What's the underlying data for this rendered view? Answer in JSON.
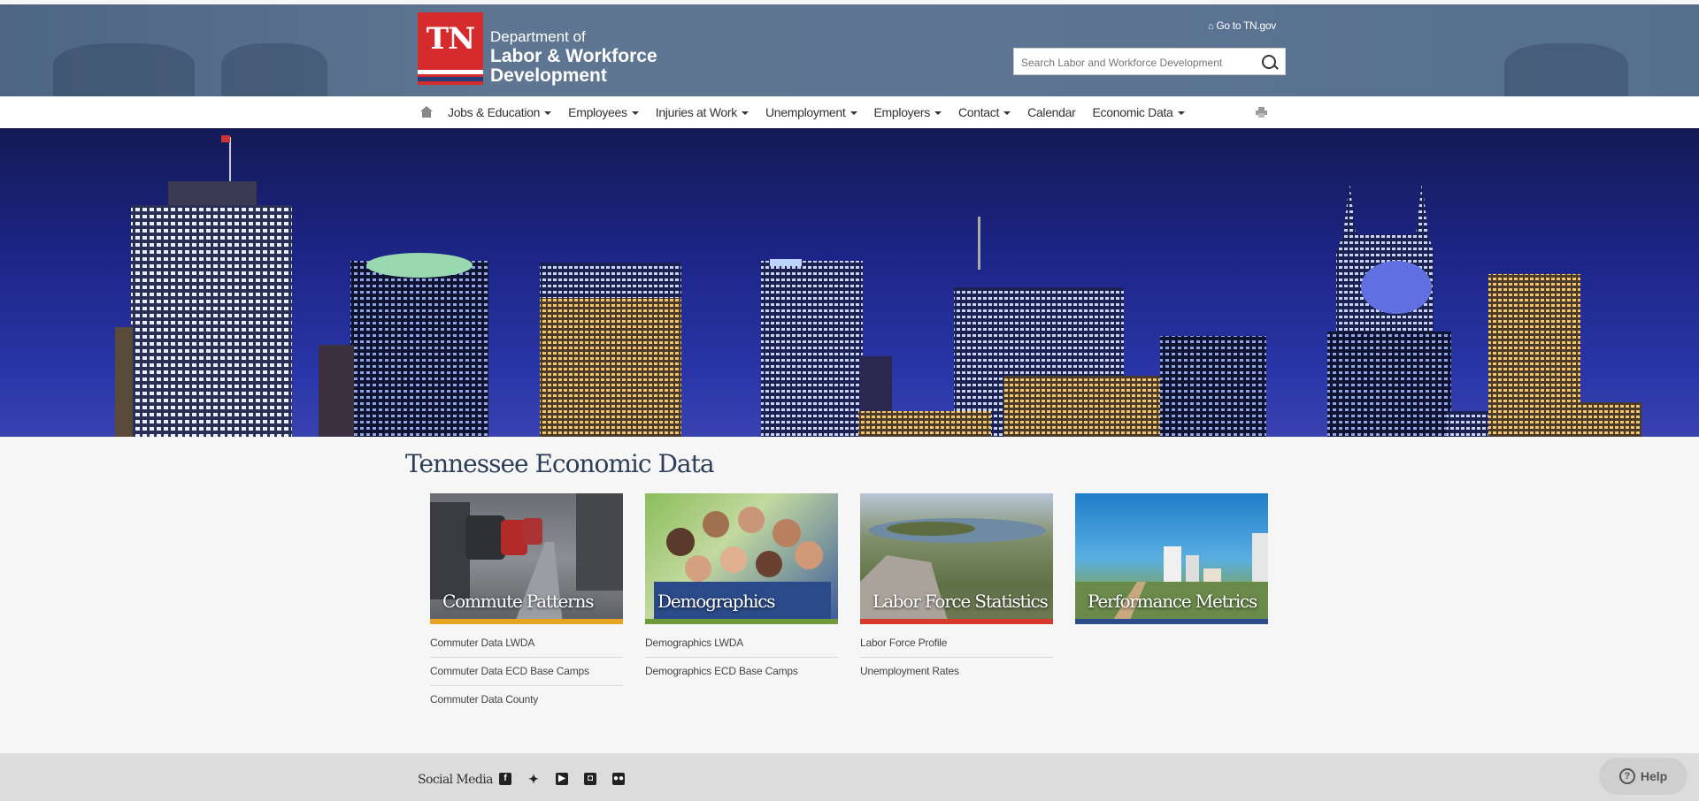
{
  "header": {
    "logo_text": "TN",
    "dept_line1": "Department of",
    "dept_line2": "Labor & Workforce",
    "dept_line3": "Development",
    "goto_link": "Go to TN.gov",
    "search_placeholder": "Search Labor and Workforce Development"
  },
  "nav": {
    "items": [
      {
        "label": "Jobs & Education",
        "dropdown": true
      },
      {
        "label": "Employees",
        "dropdown": true
      },
      {
        "label": "Injuries at Work",
        "dropdown": true
      },
      {
        "label": "Unemployment",
        "dropdown": true
      },
      {
        "label": "Employers",
        "dropdown": true
      },
      {
        "label": "Contact",
        "dropdown": true
      },
      {
        "label": "Calendar",
        "dropdown": false
      },
      {
        "label": "Economic Data",
        "dropdown": true
      }
    ]
  },
  "main": {
    "title": "Tennessee Economic Data",
    "cards": [
      {
        "caption": "Commute Patterns",
        "bar_color": "#e8a325",
        "links": [
          "Commuter Data LWDA",
          "Commuter Data ECD Base Camps",
          "Commuter Data County"
        ]
      },
      {
        "caption": "Demographics",
        "bar_color": "#6e9a3a",
        "links": [
          "Demographics LWDA",
          "Demographics ECD Base Camps"
        ]
      },
      {
        "caption": "Labor Force Statistics",
        "bar_color": "#d53a2c",
        "links": [
          "Labor Force Profile",
          "Unemployment Rates"
        ]
      },
      {
        "caption": "Performance Metrics",
        "bar_color": "#2b4b8a",
        "links": []
      }
    ]
  },
  "footer": {
    "social_label": "Social Media",
    "social_icons": [
      "facebook-icon",
      "twitter-icon",
      "youtube-icon",
      "instagram-icon",
      "flickr-icon"
    ]
  },
  "help": {
    "label": "Help"
  },
  "colors": {
    "brand_red": "#d52b2d",
    "header_blue": "#5a7291",
    "title_navy": "#2c3e58"
  }
}
